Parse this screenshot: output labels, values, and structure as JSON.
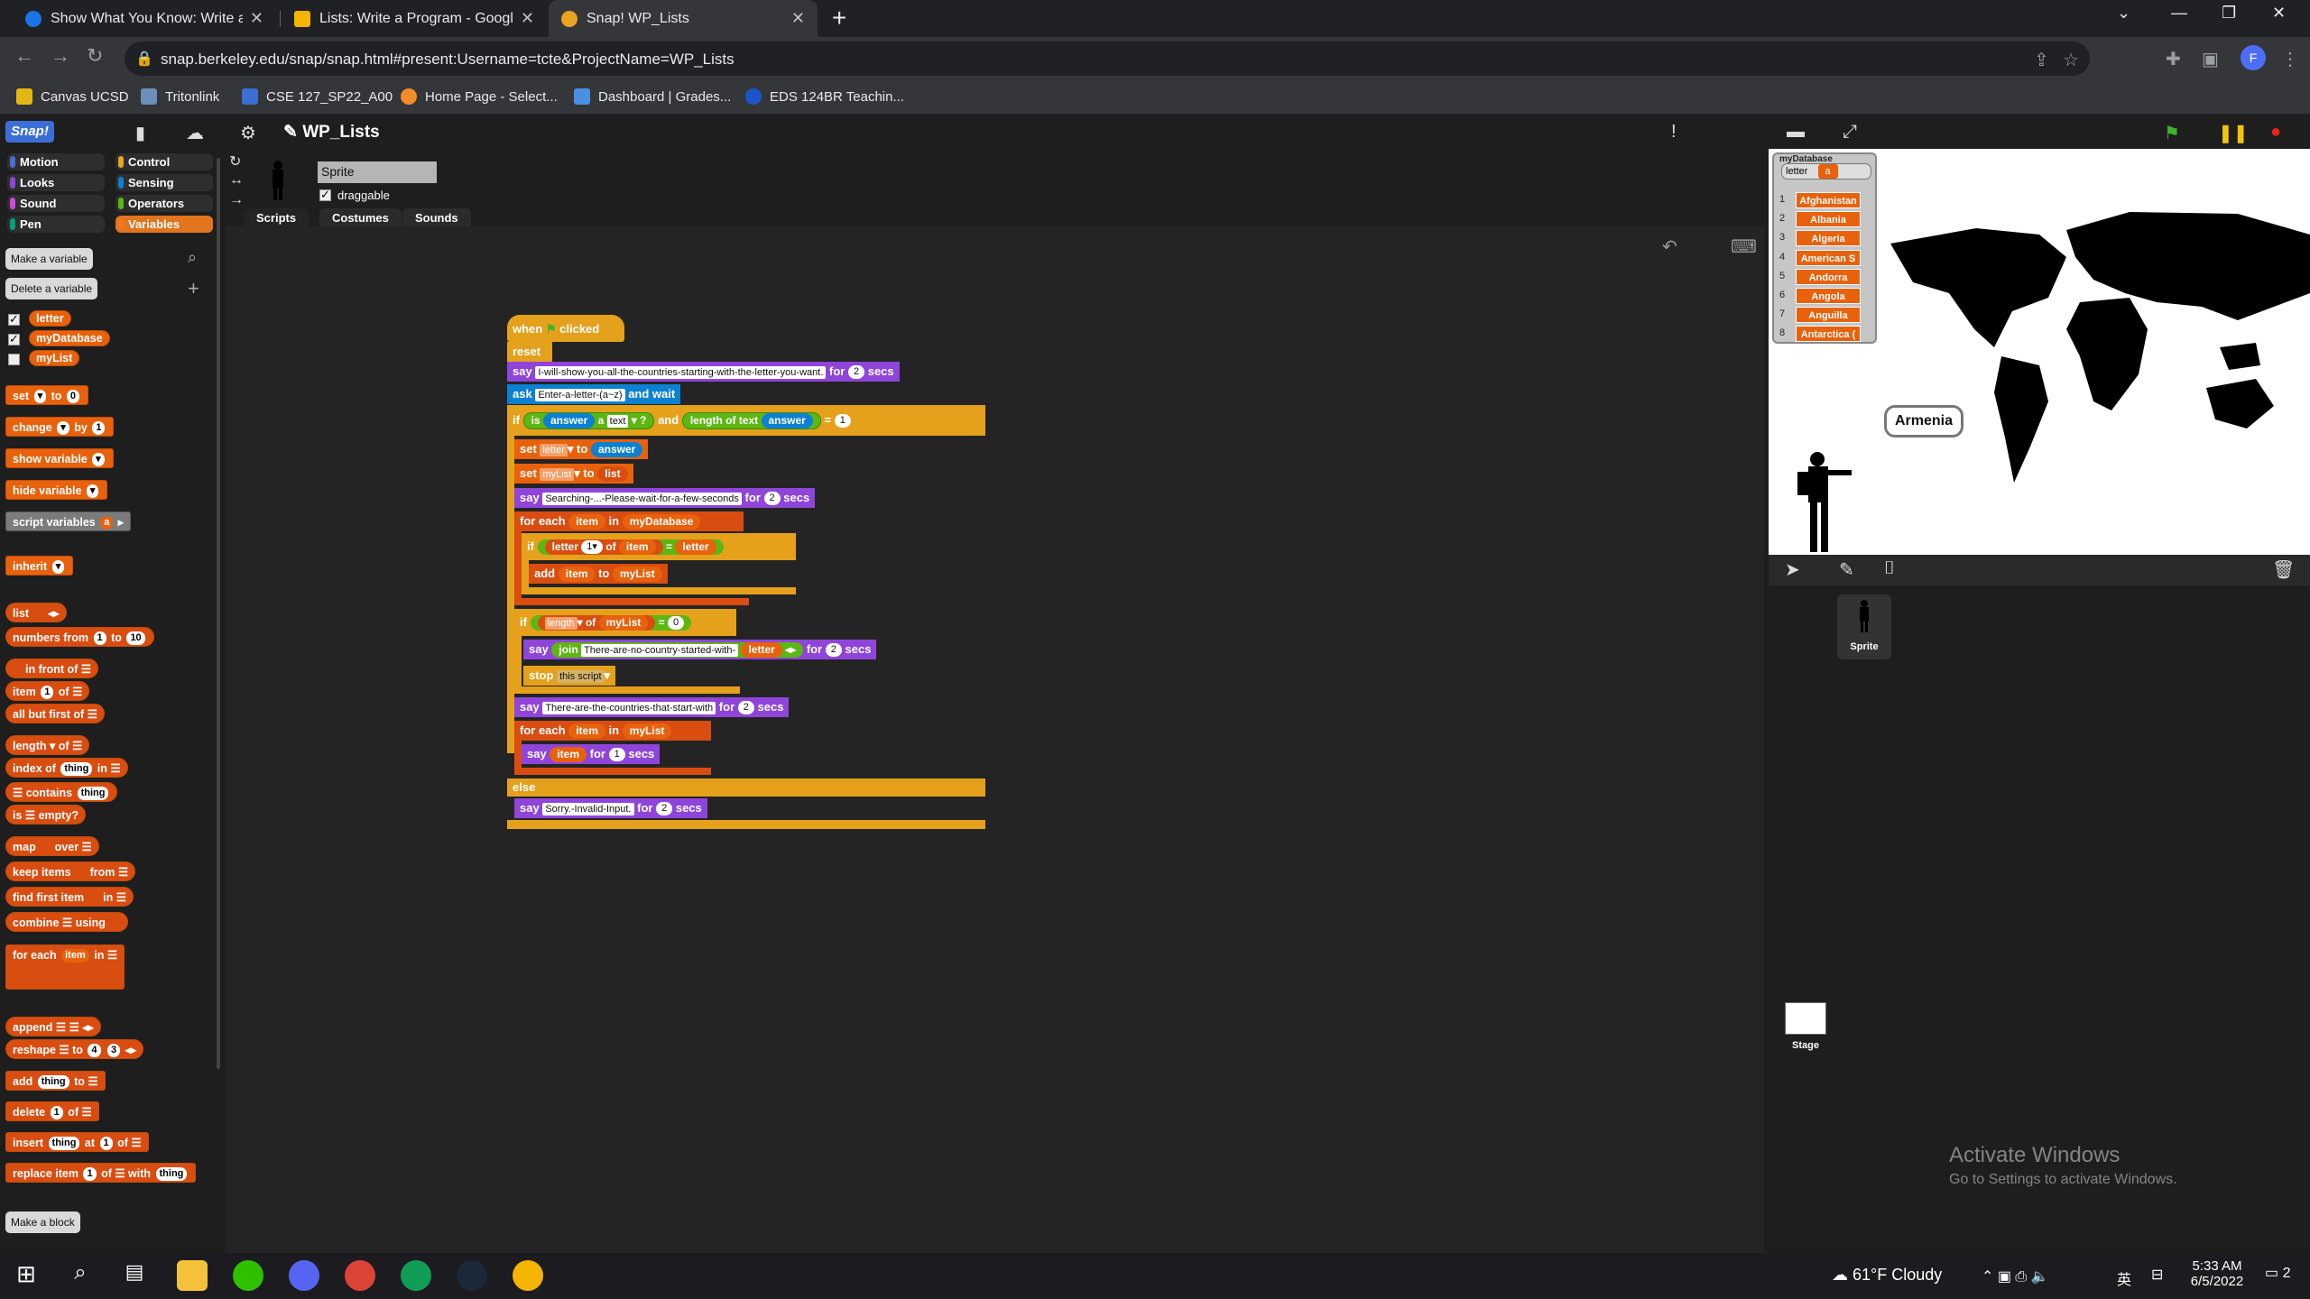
{
  "browser": {
    "tabs": [
      {
        "title": "Show What You Know: Write and",
        "color": "#1a73e8"
      },
      {
        "title": "Lists: Write a Program - Google S",
        "color": "#f4b400"
      },
      {
        "title": "Snap! WP_Lists",
        "color": "#e8a423"
      }
    ],
    "url": "snap.berkeley.edu/snap/snap.html#present:Username=tcte&ProjectName=WP_Lists",
    "profile_initial": "F",
    "bookmarks": [
      "Canvas UCSD",
      "Tritonlink",
      "CSE 127_SP22_A00",
      "Home Page - Select...",
      "Dashboard | Grades...",
      "EDS 124BR Teachin..."
    ]
  },
  "snap": {
    "logo": "Snap!",
    "project_title": "WP_Lists",
    "categories": [
      "Motion",
      "Looks",
      "Sound",
      "Pen",
      "Control",
      "Sensing",
      "Operators",
      "Variables"
    ],
    "selected_category": "Variables",
    "palette_buttons": {
      "make_variable": "Make a variable",
      "delete_variable": "Delete a variable",
      "make_block": "Make a block"
    },
    "variables": [
      {
        "name": "letter",
        "checked": true
      },
      {
        "name": "myDatabase",
        "checked": true
      },
      {
        "name": "myList",
        "checked": false
      }
    ],
    "palette_blocks": {
      "set": "set",
      "to": "to",
      "set_val": "0",
      "change": "change",
      "by": "by",
      "change_val": "1",
      "show_variable": "show variable",
      "hide_variable": "hide variable",
      "script_variables": "script variables",
      "sv_a": "a",
      "inherit": "inherit",
      "list": "list",
      "numbers_from": "numbers from",
      "nf_1": "1",
      "nf_to": "to",
      "nf_10": "10",
      "in_front_of": "in front of",
      "item": "item",
      "item_1": "1",
      "item_of": "of",
      "all_but_first_of": "all but first of",
      "length": "length",
      "length_of": "of",
      "index_of": "index of",
      "thing": "thing",
      "index_in": "in",
      "contains": "contains",
      "is_empty": "is",
      "is_empty2": "empty?",
      "map": "map",
      "over": "over",
      "keep_items": "keep items",
      "from": "from",
      "find_first_item": "find first item",
      "in": "in",
      "combine": "combine",
      "using": "using",
      "for_each": "for each",
      "for_each_item": "item",
      "for_each_in": "in",
      "append": "append",
      "reshape": "reshape",
      "reshape_to": "to",
      "reshape_4": "4",
      "reshape_3": "3",
      "add": "add",
      "add_to": "to",
      "delete": "delete",
      "delete_1": "1",
      "delete_of": "of",
      "insert": "insert",
      "insert_at": "at",
      "insert_1": "1",
      "insert_of": "of",
      "replace_item": "replace item",
      "replace_1": "1",
      "replace_of": "of",
      "replace_with": "with"
    },
    "sprite": {
      "name": "Sprite",
      "draggable_label": "draggable"
    },
    "tabs": [
      "Scripts",
      "Costumes",
      "Sounds"
    ],
    "script": {
      "hat_when": "when",
      "hat_clicked": "clicked",
      "reset": "reset",
      "say1": "say",
      "say1_text": "I-will-show-you-all-the-countries-starting-with-the-letter-you-want.",
      "say1_for": "for",
      "say1_n": "2",
      "say1_secs": "secs",
      "ask": "ask",
      "ask_text": "Enter-a-letter-(a~z)",
      "ask_wait": "and wait",
      "if1": "if",
      "is": "is",
      "answer": "answer",
      "a": "a",
      "text": "text",
      "q": "?",
      "and": "and",
      "length_of_text": "length of text",
      "eq": "=",
      "one": "1",
      "set_letter": "set",
      "letter": "letter",
      "to": "to",
      "set_mylist": "set",
      "mylist": "myList",
      "list": "list",
      "say2": "say",
      "say2_text": "Searching-...-Please-wait-for-a-few-seconds",
      "say2_for": "for",
      "say2_n": "2",
      "say2_secs": "secs",
      "foreach1": "for each",
      "item": "item",
      "in": "in",
      "mydatabase": "myDatabase",
      "if2": "if",
      "letter_block": "letter",
      "of": "of",
      "letter_var": "letter",
      "add": "add",
      "if3": "if",
      "length": "length",
      "zero": "0",
      "say3": "say",
      "join": "join",
      "say3_text": "There-are-no-country-started-with-",
      "say3_for": "for",
      "say3_n": "2",
      "say3_secs": "secs",
      "stop": "stop",
      "this_script": "this script",
      "say4": "say",
      "say4_text": "There-are-the-countries-that-start-with",
      "say4_for": "for",
      "say4_n": "2",
      "say4_secs": "secs",
      "foreach2": "for each",
      "say5": "say",
      "say5_for": "for",
      "say5_n": "1",
      "say5_secs": "secs",
      "else": "else",
      "say6": "say",
      "say6_text": "Sorry.-Invalid-Input.",
      "say6_for": "for",
      "say6_n": "2",
      "say6_secs": "secs"
    },
    "stage": {
      "watcher_title": "myDatabase",
      "watcher_letter_label": "letter",
      "watcher_letter_val": "a",
      "list_items": [
        "Afghanistan",
        "Albania",
        "Algeria",
        "American S",
        "Andorra",
        "Angola",
        "Anguilla",
        "Antarctica ("
      ],
      "list_index": [
        "1",
        "2",
        "3",
        "4",
        "5",
        "6",
        "7",
        "8"
      ],
      "speech": "Armenia"
    },
    "corral": {
      "sprite_label": "Sprite",
      "stage_label": "Stage"
    }
  },
  "activate_windows": {
    "title": "Activate Windows",
    "subtitle": "Go to Settings to activate Windows."
  },
  "taskbar": {
    "weather": "61°F  Cloudy",
    "time": "5:33 AM",
    "date": "6/5/2022",
    "lang": "英",
    "notif": "2"
  }
}
